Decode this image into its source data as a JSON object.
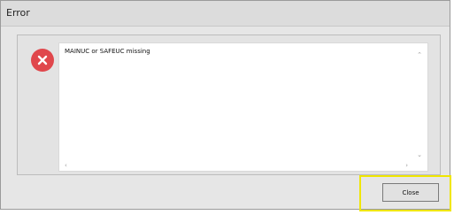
{
  "window": {
    "title": "Error"
  },
  "message": {
    "text": "MAINUC or SAFEUC missing"
  },
  "icons": {
    "error": "error-icon",
    "scroll_up": "chevron-up-icon",
    "scroll_down": "chevron-down-icon",
    "scroll_left": "chevron-left-icon",
    "scroll_right": "chevron-right-icon"
  },
  "buttons": {
    "close_label": "Close"
  },
  "colors": {
    "error_red": "#e0474c",
    "highlight": "#f0e600"
  }
}
